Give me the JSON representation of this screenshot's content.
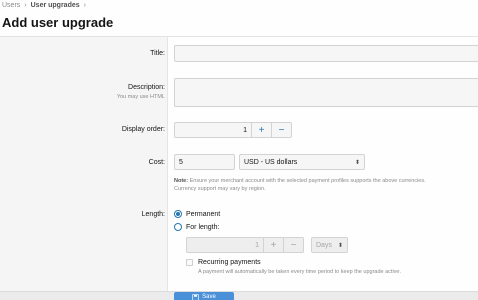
{
  "breadcrumb": {
    "items": [
      "Users",
      "User upgrades"
    ],
    "separator": "›"
  },
  "page": {
    "title": "Add user upgrade"
  },
  "form": {
    "title_label": "Title:",
    "title_value": "",
    "description_label": "Description:",
    "description_hint": "You may use HTML",
    "description_value": "",
    "display_order_label": "Display order:",
    "display_order_value": "1",
    "cost_label": "Cost:",
    "cost_value": "5",
    "currency_value": "USD - US dollars",
    "note_prefix": "Note:",
    "note_text": "Ensure your merchant account with the selected payment profiles supports the above currencies.",
    "note_text_2": "Currency support may vary by region.",
    "length_label": "Length:",
    "permanent_label": "Permanent",
    "for_length_label": "For length:",
    "length_value": "1",
    "length_unit_value": "Days",
    "recurring_label": "Recurring payments",
    "recurring_hint": "A payment will automatically be taken every time period to keep the upgrade active.",
    "save_label": "Save"
  },
  "icons": {
    "plus": "+",
    "minus": "−",
    "updown": "⬍"
  },
  "colors": {
    "accent": "#2577b1",
    "button": "#4a90d9"
  }
}
